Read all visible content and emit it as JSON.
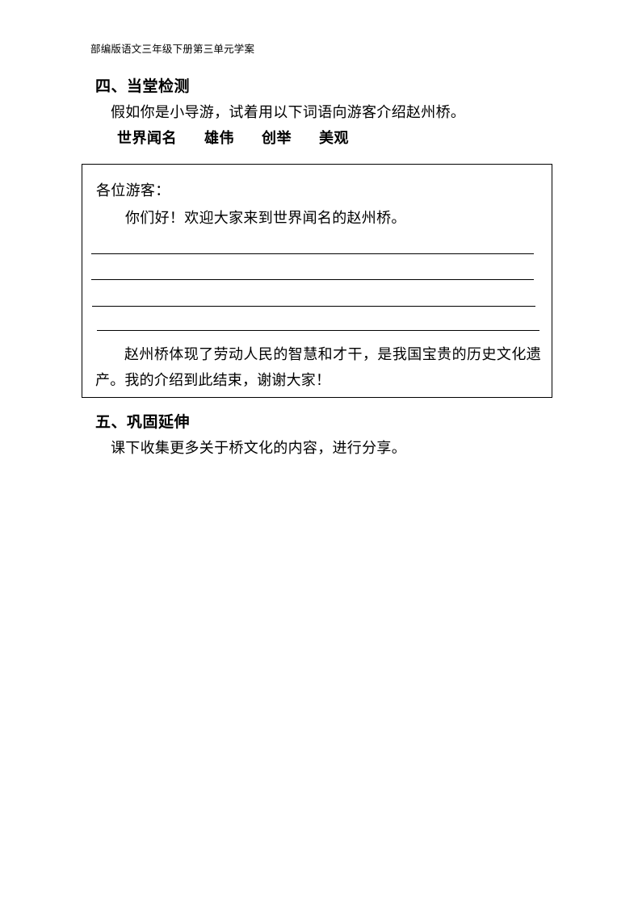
{
  "document": {
    "running_header": "部编版语文三年级下册第三单元学案",
    "page_background": "#ffffff",
    "text_color": "#000000",
    "border_color": "#000000"
  },
  "section_four": {
    "heading": "四、当堂检测",
    "instruction": "假如你是小导游，试着用以下词语向游客介绍赵州桥。",
    "key_words": [
      "世界闻名",
      "雄伟",
      "创举",
      "美观"
    ]
  },
  "answer_box": {
    "salutation": "各位游客：",
    "greeting": "你们好！欢迎大家来到世界闻名的赵州桥。",
    "blank_lines_count": 4,
    "closing": "赵州桥体现了劳动人民的智慧和才干，是我国宝贵的历史文化遗产。我的介绍到此结束，谢谢大家！"
  },
  "section_five": {
    "heading": "五、巩固延伸",
    "instruction": "课下收集更多关于桥文化的内容，进行分享。"
  }
}
